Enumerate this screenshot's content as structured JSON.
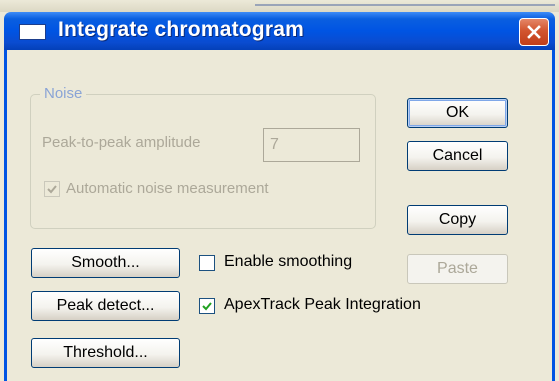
{
  "dialog": {
    "title": "Integrate chromatogram"
  },
  "noise_group": {
    "label": "Noise",
    "amplitude_label": "Peak-to-peak amplitude",
    "amplitude_value": "7",
    "auto_checkbox_label": "Automatic noise measurement",
    "auto_checked": true
  },
  "buttons": {
    "ok": "OK",
    "cancel": "Cancel",
    "copy": "Copy",
    "paste": "Paste",
    "smooth": "Smooth...",
    "peak_detect": "Peak detect...",
    "threshold": "Threshold..."
  },
  "options": {
    "enable_smoothing_label": "Enable smoothing",
    "enable_smoothing_checked": false,
    "apextrack_label": "ApexTrack Peak Integration",
    "apextrack_checked": true
  },
  "colors": {
    "titlebar": "#0054e3",
    "close_button": "#d2552f",
    "dialog_face": "#ece9d8",
    "disabled_text": "#aca899",
    "group_label": "#8aa4d6"
  }
}
